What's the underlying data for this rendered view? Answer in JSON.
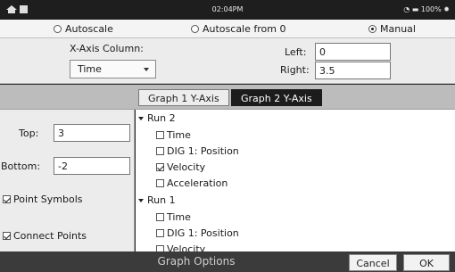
{
  "statusbar": {
    "time": "02:04PM",
    "battery": "100%"
  },
  "scale_mode": {
    "options": [
      "Autoscale",
      "Autoscale from 0",
      "Manual"
    ],
    "selected": "Manual"
  },
  "x_axis": {
    "column_label": "X-Axis Column:",
    "column_value": "Time",
    "left_label": "Left:",
    "left_value": "0",
    "right_label": "Right:",
    "right_value": "3.5"
  },
  "tabs": [
    {
      "label": "Graph 1 Y-Axis",
      "active": false
    },
    {
      "label": "Graph 2 Y-Axis",
      "active": true
    }
  ],
  "y_axis": {
    "top_label": "Top:",
    "top_value": "3",
    "bottom_label": "Bottom:",
    "bottom_value": "-2"
  },
  "options": {
    "point_symbols": {
      "label": "Point Symbols",
      "checked": true
    },
    "connect_points": {
      "label": "Connect Points",
      "checked": true
    }
  },
  "runs": [
    {
      "name": "Run 2",
      "items": [
        {
          "label": "Time",
          "checked": false
        },
        {
          "label": "DIG 1: Position",
          "checked": false
        },
        {
          "label": "Velocity",
          "checked": true
        },
        {
          "label": "Acceleration",
          "checked": false
        }
      ]
    },
    {
      "name": "Run 1",
      "items": [
        {
          "label": "Time",
          "checked": false
        },
        {
          "label": "DIG 1: Position",
          "checked": false
        },
        {
          "label": "Velocity",
          "checked": false
        }
      ]
    }
  ],
  "footer": {
    "title": "Graph Options",
    "cancel_label": "Cancel",
    "ok_label": "OK"
  }
}
